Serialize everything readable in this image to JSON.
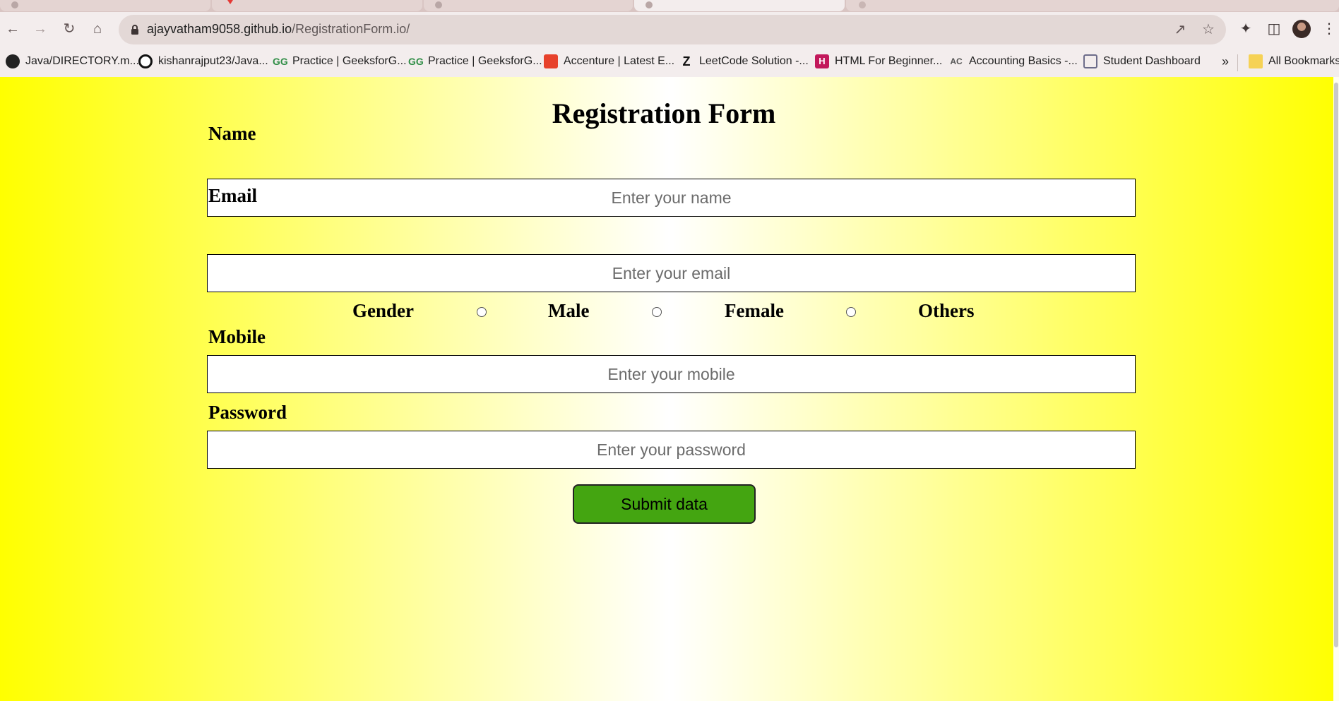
{
  "browser": {
    "url_host": "ajayvatham9058.github.io",
    "url_path": "/RegistrationForm.io/",
    "bookmarks": [
      {
        "label": "Java/DIRECTORY.m...",
        "icon": "github-icon"
      },
      {
        "label": "kishanrajput23/Java...",
        "icon": "github-icon"
      },
      {
        "label": "Practice | GeeksforG...",
        "icon": "geeksforgeeks-icon"
      },
      {
        "label": "Practice | GeeksforG...",
        "icon": "geeksforgeeks-icon"
      },
      {
        "label": "Accenture | Latest E...",
        "icon": "accenture-icon"
      },
      {
        "label": "LeetCode Solution -...",
        "icon": "zeta-icon"
      },
      {
        "label": "HTML For Beginner...",
        "icon": "html-icon"
      },
      {
        "label": "Accounting Basics -...",
        "icon": "accounting-icon"
      },
      {
        "label": "Student Dashboard",
        "icon": "dashboard-icon"
      }
    ],
    "overflow_label": "»",
    "all_bookmarks_label": "All Bookmarks",
    "colors": {
      "toolbar": "#f3eded",
      "tabstrip": "#d9c5c3",
      "omnibox": "#e3d8d6"
    }
  },
  "form": {
    "title": "Registration Form",
    "name_label": "Name",
    "name_placeholder": "Enter your name",
    "email_label": "Email",
    "email_placeholder": "Enter your email",
    "gender_label": "Gender",
    "gender_options": [
      "Male",
      "Female",
      "Others"
    ],
    "mobile_label": "Mobile",
    "mobile_placeholder": "Enter your mobile",
    "password_label": "Password",
    "password_placeholder": "Enter your password",
    "submit_label": "Submit data",
    "colors": {
      "background_edge": "#ffff00",
      "background_center": "#ffffff",
      "submit": "#44a511"
    }
  }
}
